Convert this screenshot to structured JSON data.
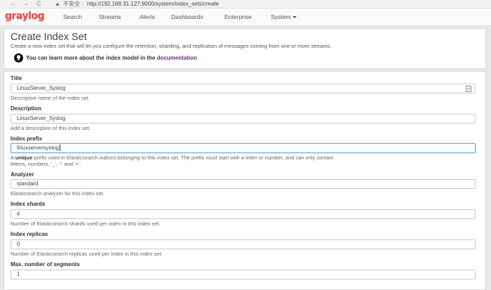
{
  "browser": {
    "back_glyph": "←",
    "forward_glyph": "→",
    "reload_glyph": "C",
    "warning_glyph": "▲",
    "security_label": "不安全",
    "separator": "|",
    "url": "http://192.168.31.127:9000/system/index_sets/create"
  },
  "navbar": {
    "logo": "graylog",
    "items": [
      "Search",
      "Streams",
      "Alerts",
      "Dashboards",
      "Enterprise"
    ],
    "system_label": "System"
  },
  "header": {
    "title": "Create Index Set",
    "subtitle": "Create a new index set that will let you configure the retention, sharding, and replication of messages coming from one or more streams.",
    "info_prefix": "You can learn more about the index model in the",
    "info_link": "documentation"
  },
  "form": {
    "title": {
      "label": "Title",
      "value": "LinuxServer_Syslog",
      "help": "Descriptive name of the index set."
    },
    "description": {
      "label": "Description",
      "value": "LinuxServer_Syslog",
      "help": "Add a description of this index set."
    },
    "index_prefix": {
      "label": "Index prefix",
      "value": "linuxserversyslog",
      "help_pre": "A ",
      "help_bold": "unique",
      "help_post": " prefix used in Elasticsearch indices belonging to this index set. The prefix must start with a letter or number, and can only contain",
      "help_line2": "letters, numbers, '_', '-' and '+'."
    },
    "analyzer": {
      "label": "Analyzer",
      "value": "standard",
      "help": "Elasticsearch analyzer for this index set."
    },
    "shards": {
      "label": "Index shards",
      "value": "4",
      "help": "Number of Elasticsearch shards used per index in this index set."
    },
    "replicas": {
      "label": "Index replicas",
      "value": "0",
      "help": "Number of Elasticsearch replicas used per index in this index set."
    },
    "segments": {
      "label": "Max. number of segments",
      "value": "1"
    }
  }
}
